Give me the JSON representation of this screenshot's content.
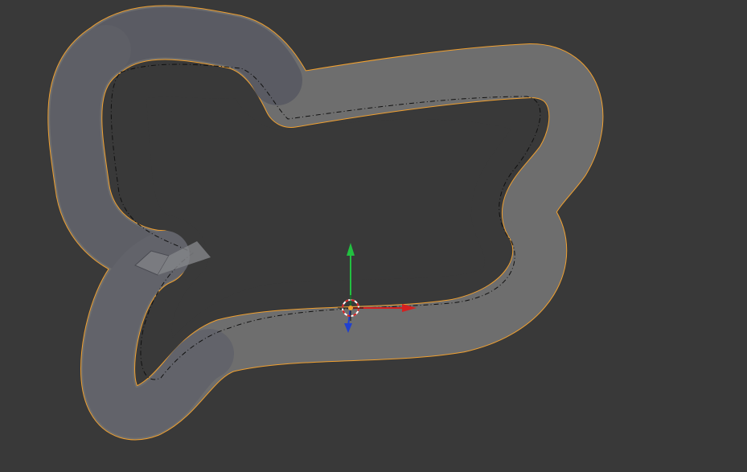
{
  "viewport": {
    "background": "#393939",
    "selection_outline_color": "#f0a030",
    "mesh_color": "#6e6e6e",
    "mesh_shadow_color": "#5a5b63",
    "curve_path_color": "#111111"
  },
  "object": {
    "name_icon": "track-mesh-icon",
    "selected": true
  },
  "manipulator": {
    "x_axis_color": "#d62020",
    "y_axis_color": "#22c040",
    "z_axis_color": "#2040d0",
    "origin_icon": "3d-cursor-icon"
  }
}
